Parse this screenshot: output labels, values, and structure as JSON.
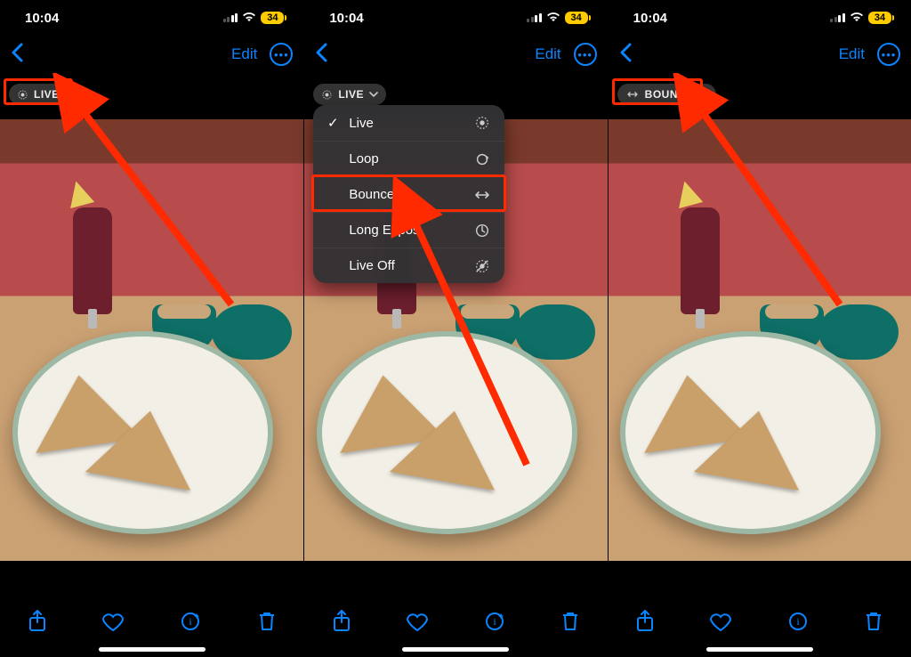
{
  "status": {
    "time": "10:04",
    "battery": "34"
  },
  "nav": {
    "edit": "Edit"
  },
  "badges": {
    "live": "LIVE",
    "bounce": "BOUNCE"
  },
  "menu": {
    "items": [
      {
        "label": "Live",
        "checked": true
      },
      {
        "label": "Loop",
        "checked": false
      },
      {
        "label": "Bounce",
        "checked": false
      },
      {
        "label": "Long Expos",
        "checked": false
      },
      {
        "label": "Live Off",
        "checked": false
      }
    ]
  },
  "accent": "#0a84ff",
  "highlight": "#ff2a00"
}
